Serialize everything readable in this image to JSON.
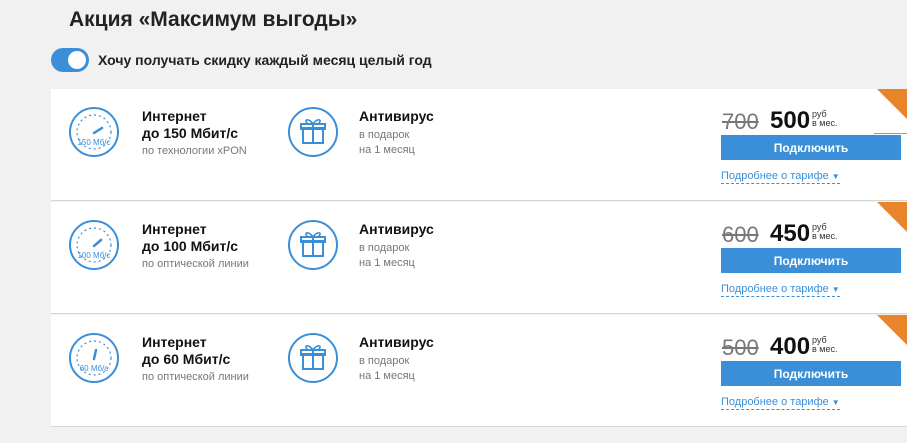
{
  "page": {
    "title": "Акция «Максимум выгоды»"
  },
  "toggle": {
    "label": "Хочу получать скидку каждый месяц целый год",
    "on": true
  },
  "colors": {
    "accent": "#3b8fd8",
    "corner": "#e8842a"
  },
  "cards": [
    {
      "speed_icon_label": "150 Мб/с",
      "title_line1": "Интернет",
      "title_line2": "до 150 Мбит/с",
      "subtitle": "по технологии xPON",
      "gift_title": "Антивирус",
      "gift_line1": "в подарок",
      "gift_line2": "на 1 месяц",
      "old_price": "700",
      "new_price": "500",
      "currency_line1": "руб",
      "currency_line2": "в мес.",
      "button_label": "Подключить",
      "details_label": "Подробнее о тарифе",
      "speed_icons": [
        "speedometer-icon",
        "gift-icon"
      ]
    },
    {
      "speed_icon_label": "100 Мб/с",
      "title_line1": "Интернет",
      "title_line2": "до 100 Мбит/с",
      "subtitle": "по оптической линии",
      "gift_title": "Антивирус",
      "gift_line1": "в подарок",
      "gift_line2": "на 1 месяц",
      "old_price": "600",
      "new_price": "450",
      "currency_line1": "руб",
      "currency_line2": "в мес.",
      "button_label": "Подключить",
      "details_label": "Подробнее о тарифе"
    },
    {
      "speed_icon_label": "60 Мб/с",
      "title_line1": "Интернет",
      "title_line2": "до 60 Мбит/с",
      "subtitle": "по оптической линии",
      "gift_title": "Антивирус",
      "gift_line1": "в подарок",
      "gift_line2": "на 1 месяц",
      "old_price": "500",
      "new_price": "400",
      "currency_line1": "руб",
      "currency_line2": "в мес.",
      "button_label": "Подключить",
      "details_label": "Подробнее о тарифе"
    }
  ]
}
